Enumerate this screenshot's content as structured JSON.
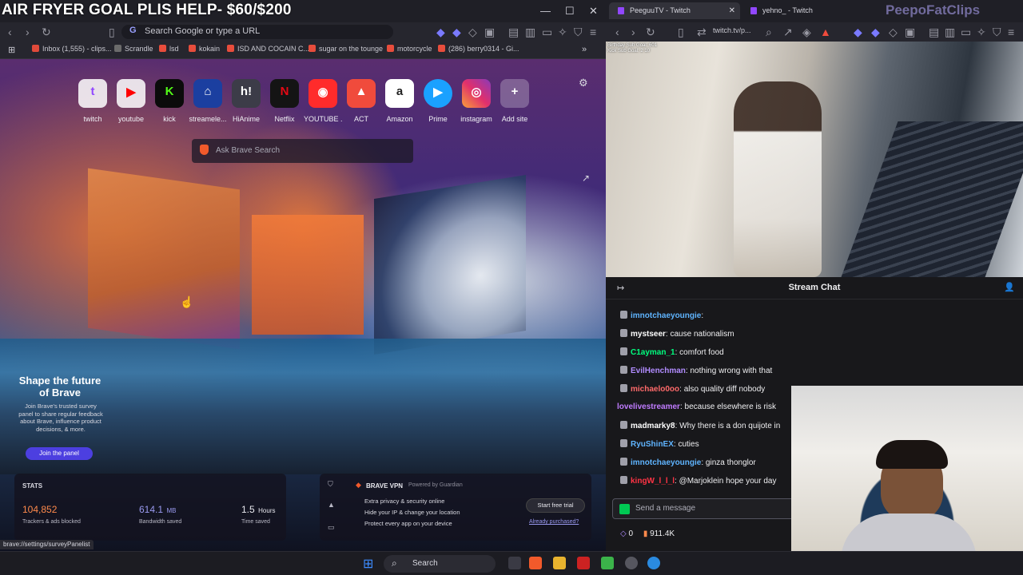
{
  "overlay_title": "AIR FRYER GOAL PLIS HELP- $60/$200",
  "left_browser": {
    "omnibox_placeholder": "Search Google or type a URL",
    "bookmarks": [
      {
        "label": "Inbox (1,555) - clips...",
        "color": "#e04a3a"
      },
      {
        "label": "Scrandle",
        "color": "#6b6b6b"
      },
      {
        "label": "lsd",
        "color": "#e84d3c"
      },
      {
        "label": "kokain",
        "color": "#e84d3c"
      },
      {
        "label": "ISD AND COCAIN C...",
        "color": "#e84d3c"
      },
      {
        "label": "sugar on the tounge",
        "color": "#e84d3c"
      },
      {
        "label": "motorcycle",
        "color": "#e84d3c"
      },
      {
        "label": "(286) berry0314 - Gi...",
        "color": "#e84d3c"
      }
    ],
    "tiles": [
      {
        "label": "twitch",
        "glyph": "t",
        "color": "#9147ff"
      },
      {
        "label": "youtube",
        "glyph": "▶",
        "color": "#ff0000"
      },
      {
        "label": "kick",
        "glyph": "K",
        "color": "#53fc18"
      },
      {
        "label": "streamele...",
        "glyph": "⌂",
        "color": "#1b6bff"
      },
      {
        "label": "HiAnime",
        "glyph": "h!",
        "color": "#7a5cc0"
      },
      {
        "label": "Netflix",
        "glyph": "N",
        "color": "#e50914"
      },
      {
        "label": "YOUTUBE ...",
        "glyph": "◉",
        "color": "#ff2b2b"
      },
      {
        "label": "ACT",
        "glyph": "▲",
        "color": "#f04b3c"
      },
      {
        "label": "Amazon",
        "glyph": "a",
        "color": "#222222"
      },
      {
        "label": "Prime",
        "glyph": "▶",
        "color": "#1aa1ff"
      },
      {
        "label": "instagram",
        "glyph": "◎",
        "color": "#e1306c"
      },
      {
        "label": "Add site",
        "glyph": "+",
        "color": "#d0d0d8"
      }
    ],
    "search_placeholder": "Ask Brave Search",
    "survey": {
      "heading": "Shape the future of Brave",
      "body": "Join Brave's trusted survey panel to share regular feedback about Brave, influence product decisions, & more.",
      "button": "Join the panel"
    },
    "stats": {
      "title": "STATS",
      "items": [
        {
          "value": "104,852",
          "unit": "",
          "label": "Trackers & ads blocked",
          "color": "#ff8a4c"
        },
        {
          "value": "614.1",
          "unit": "MB",
          "label": "Bandwidth saved",
          "color": "#9a9af0"
        },
        {
          "value": "1.5",
          "unit": "Hours",
          "label": "Time saved",
          "color": "#ffffff"
        }
      ]
    },
    "vpn": {
      "title": "BRAVE VPN",
      "powered": "Powered by Guardian",
      "features": [
        "Extra privacy & security online",
        "Hide your IP & change your location",
        "Protect every app on your device"
      ],
      "button": "Start free trial",
      "link": "Already purchased?"
    },
    "status_url": "brave://settings/surveyPanelist"
  },
  "right_browser": {
    "tabs": [
      {
        "label": "PeeguuTV - Twitch"
      },
      {
        "label": "yehno_ - Twitch"
      }
    ],
    "watermark": "PeepoFatClips",
    "url": "twitch.tv/p...",
    "video_overlay": [
      "Birthday Sub Goal: 601",
      "Kick Sub Goal: 2 10"
    ],
    "chat_title": "Stream Chat",
    "messages": [
      {
        "user": "imnotchaeyoungie",
        "text": ":",
        "color": "#5fb4ff"
      },
      {
        "user": "mystseer",
        "text": ": cause nationalism",
        "color": "#ffffff"
      },
      {
        "user": "C1ayman_1",
        "text": ": comfort food",
        "color": "#00ff7f"
      },
      {
        "user": "EvilHenchman",
        "text": ": nothing wrong with that",
        "color": "#b18cff"
      },
      {
        "user": "michaelo0oo",
        "text": ": also quality diff nobody",
        "color": "#ff6a6a"
      },
      {
        "user": "lovelivestreamer",
        "text": ": because elsewhere is risk",
        "color": "#c07cff"
      },
      {
        "user": "madmarky8",
        "text": ": Why there is a don quijote in",
        "color": "#ffffff"
      },
      {
        "user": "RyuShinEX",
        "text": ":     cuties",
        "color": "#5fb4ff"
      },
      {
        "user": "imnotchaeyoungie",
        "text": ": ginza thonglor",
        "color": "#5fb4ff"
      },
      {
        "user": "kingW_l_l_l",
        "text": ": @Marjoklein hope your day",
        "color": "#ff3344"
      }
    ],
    "chat_placeholder": "Send a message",
    "points": "0",
    "viewers": "911.4K"
  },
  "taskbar": {
    "search_label": "Search"
  }
}
